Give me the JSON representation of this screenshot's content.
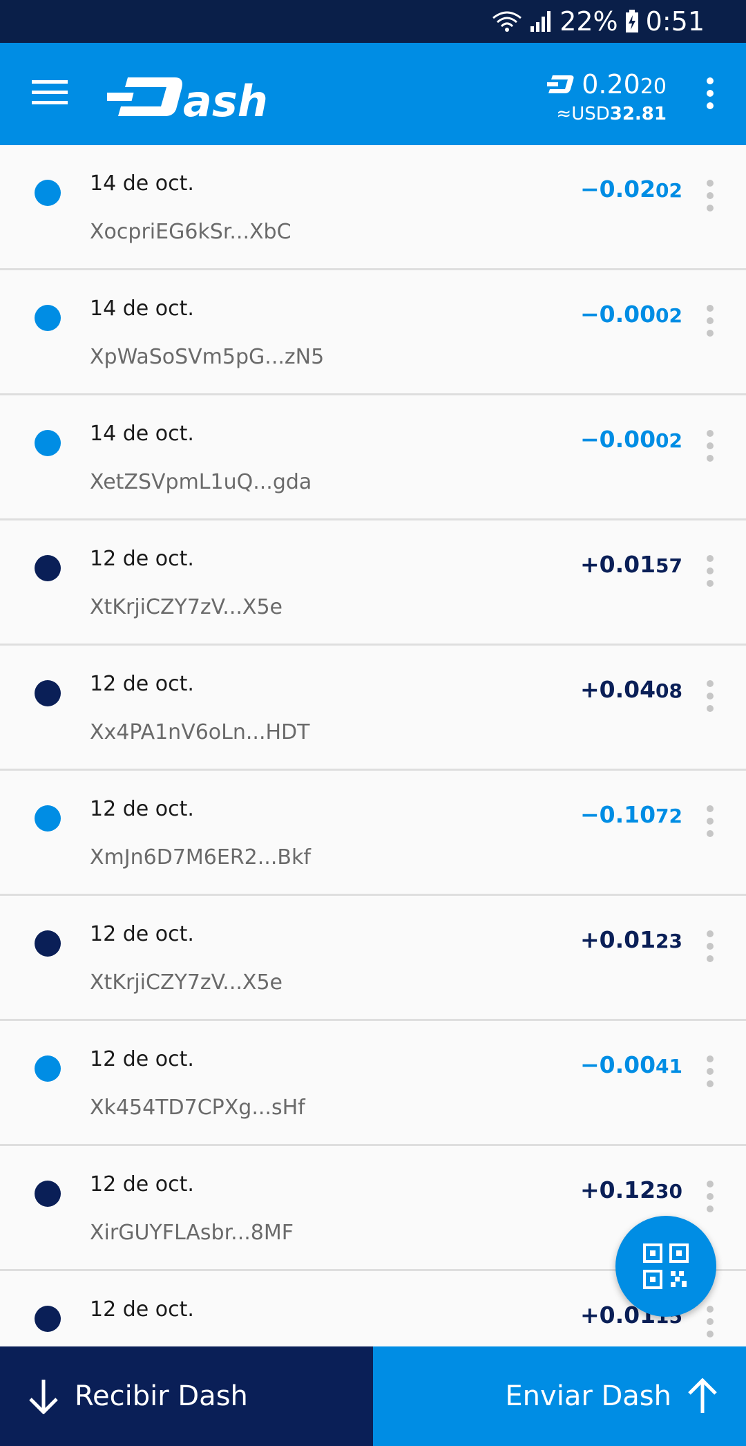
{
  "status_bar": {
    "battery": "22%",
    "time": "0:51"
  },
  "header": {
    "logo_text": "Dash",
    "balance_main": "0.20",
    "balance_tail": "20",
    "fiat_prefix": "≈",
    "fiat_currency": "USD",
    "fiat_amount": "32.81"
  },
  "colors": {
    "brand_blue": "#008de4",
    "navy": "#0a1f57",
    "sent_dot": "#008de4",
    "received_dot": "#0a1f57"
  },
  "transactions": [
    {
      "date": "14 de oct.",
      "address": "XocpriEG6kSr...XbC",
      "sign": "−",
      "amount_main": "0.02",
      "amount_tail": "02",
      "direction": "sent"
    },
    {
      "date": "14 de oct.",
      "address": "XpWaSoSVm5pG...zN5",
      "sign": "−",
      "amount_main": "0.00",
      "amount_tail": "02",
      "direction": "sent"
    },
    {
      "date": "14 de oct.",
      "address": "XetZSVpmL1uQ...gda",
      "sign": "−",
      "amount_main": "0.00",
      "amount_tail": "02",
      "direction": "sent"
    },
    {
      "date": "12 de oct.",
      "address": "XtKrjiCZY7zV...X5e",
      "sign": "+",
      "amount_main": "0.01",
      "amount_tail": "57",
      "direction": "received"
    },
    {
      "date": "12 de oct.",
      "address": "Xx4PA1nV6oLn...HDT",
      "sign": "+",
      "amount_main": "0.04",
      "amount_tail": "08",
      "direction": "received"
    },
    {
      "date": "12 de oct.",
      "address": "XmJn6D7M6ER2...Bkf",
      "sign": "−",
      "amount_main": "0.10",
      "amount_tail": "72",
      "direction": "sent"
    },
    {
      "date": "12 de oct.",
      "address": "XtKrjiCZY7zV...X5e",
      "sign": "+",
      "amount_main": "0.01",
      "amount_tail": "23",
      "direction": "received"
    },
    {
      "date": "12 de oct.",
      "address": "Xk454TD7CPXg...sHf",
      "sign": "−",
      "amount_main": "0.00",
      "amount_tail": "41",
      "direction": "sent"
    },
    {
      "date": "12 de oct.",
      "address": "XirGUYFLAsbr...8MF",
      "sign": "+",
      "amount_main": "0.12",
      "amount_tail": "30",
      "direction": "received"
    },
    {
      "date": "12 de oct.",
      "address": "",
      "sign": "+",
      "amount_main": "0.01",
      "amount_tail": "15",
      "direction": "received"
    }
  ],
  "bottom": {
    "receive_label": "Recibir Dash",
    "send_label": "Enviar Dash"
  }
}
